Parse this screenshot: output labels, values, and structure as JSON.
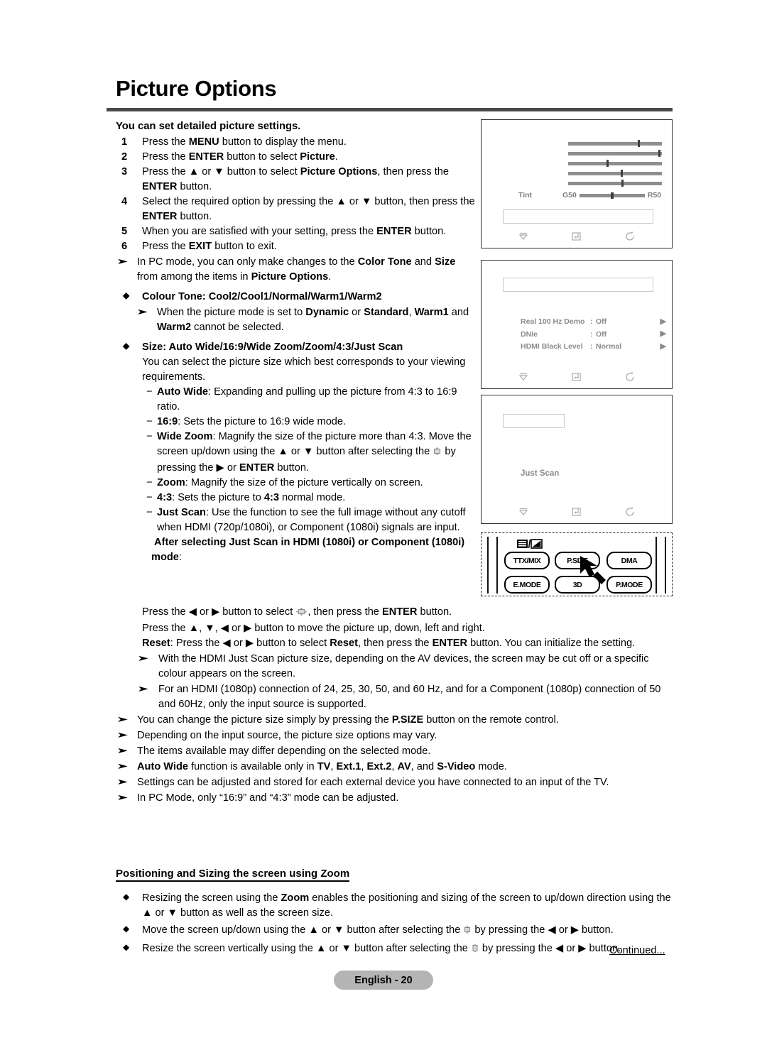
{
  "page": {
    "title": "Picture Options",
    "footer_badge": "English - 20",
    "continued": "Continued..."
  },
  "intro": {
    "lead": "You can set detailed picture settings.",
    "steps": [
      {
        "num": "1",
        "text": "Press the MENU button to display the menu.",
        "parts": [
          "Press the ",
          "MENU",
          " button to display the menu."
        ]
      },
      {
        "num": "2",
        "text": "Press the ENTER button to select Picture."
      },
      {
        "num": "3",
        "text": "Press the ▲ or ▼ button to select Picture Options, then press the ENTER button."
      },
      {
        "num": "4",
        "text": "Select the required option by pressing the ▲ or ▼ button, then press the ENTER button."
      },
      {
        "num": "5",
        "text": "When you are satisfied with your setting, press the ENTER button."
      },
      {
        "num": "6",
        "text": "Press the EXIT button to exit."
      }
    ],
    "pc_note": "In PC mode, you can only make changes to the Color Tone and Size from among the items in Picture Options."
  },
  "colour_tone": {
    "heading": "Colour Tone: Cool2/Cool1/Normal/Warm1/Warm2",
    "note": "When the picture mode is set to Dynamic or Standard, Warm1 and Warm2 cannot be selected."
  },
  "size": {
    "heading": "Size: Auto Wide/16:9/Wide Zoom/Zoom/4:3/Just Scan",
    "body": "You can select the picture size which best corresponds to your viewing requirements.",
    "items": [
      {
        "name": "Auto Wide",
        "desc": ": Expanding and pulling up the picture from 4:3 to 16:9 ratio."
      },
      {
        "name": "16:9",
        "desc": ": Sets the picture to 16:9 wide mode."
      },
      {
        "name": "Wide Zoom",
        "desc": ": Magnify the size of the picture more than 4:3. Move the screen up/down using the ▲ or ▼ button after selecting the ⬚ by pressing the ▶ or ENTER button."
      },
      {
        "name": "Zoom",
        "desc": ": Magnify the size of the picture vertically on screen."
      },
      {
        "name": "4:3",
        "desc": ": Sets the picture to 4:3 normal mode."
      },
      {
        "name": "Just Scan",
        "desc": ": Use the function to see the full image without any cutoff when HDMI (720p/1080i), or Component (1080i) signals are input."
      }
    ],
    "just_scan_heading": "After selecting Just Scan in HDMI (1080i) or Component (1080i) mode:",
    "just_scan_lines": [
      "Press the ◀ or ▶ button to select ⬚, then press the ENTER button.",
      "Press the ▲, ▼, ◀ or ▶ button to move the picture up, down, left and right.",
      "Reset: Press the ◀ or ▶ button to select Reset, then press the ENTER button. You can initialize the setting."
    ],
    "sub_notes": [
      "With the HDMI Just Scan picture size, depending on the AV devices, the screen may be cut off or a specific colour appears on the screen.",
      "For an HDMI (1080p) connection of 24, 25, 30, 50, and 60 Hz, and for a Component (1080p) connection of 50 and 60Hz, only the input source is supported."
    ]
  },
  "general_notes": [
    "You can change the picture size simply by pressing the P.SIZE button on the remote control.",
    "Depending on the input source, the picture size options may vary.",
    "The items available may differ depending on the selected mode.",
    "Auto Wide function is available only in TV, Ext.1, Ext.2, AV, and S-Video mode.",
    "Settings can be adjusted and stored for each external device you have connected to an input of the TV.",
    "In PC Mode, only “16:9” and “4:3” mode can be adjusted."
  ],
  "zoom_section": {
    "heading": "Positioning and Sizing the screen using Zoom",
    "bullets": [
      "Resizing the screen using the Zoom enables the positioning and sizing of the screen to up/down direction using the ▲ or ▼ button as well as the screen size.",
      "Move the screen up/down using the ▲ or ▼ button after selecting the ⬚ by pressing the ◀ or ▶ button.",
      "Resize the screen vertically using the ▲ or ▼ button after selecting the ⬚ by pressing the ◀ or ▶ button."
    ]
  },
  "osd_panels": [
    {
      "id": "tint-panel",
      "tint_label": "Tint",
      "tint_min_label": "G50",
      "tint_max_label": "R50",
      "sliders": [
        {
          "position_pct": 74
        },
        {
          "position_pct": 96
        },
        {
          "position_pct": 41
        },
        {
          "position_pct": 56
        },
        {
          "position_pct": 57
        }
      ],
      "tint_position_pct": 48,
      "footer_icons": [
        "move-icon",
        "enter-icon",
        "return-icon"
      ]
    },
    {
      "id": "options-panel",
      "rows": [
        {
          "name": "Real 100 Hz Demo",
          "value": "Off"
        },
        {
          "name": "DNIe",
          "value": "Off"
        },
        {
          "name": "HDMI Black Level",
          "value": "Normal"
        }
      ],
      "footer_icons": [
        "move-icon",
        "enter-icon",
        "return-icon"
      ]
    },
    {
      "id": "justscan-panel",
      "label": "Just Scan",
      "footer_icons": [
        "move-icon",
        "enter-icon",
        "return-icon"
      ]
    }
  ],
  "remote": {
    "buttons": [
      {
        "key": "ttx",
        "label": "TTX/MIX"
      },
      {
        "key": "psize",
        "label": "P.SIZE"
      },
      {
        "key": "dma",
        "label": "DMA"
      },
      {
        "key": "emode",
        "label": "E.MODE"
      },
      {
        "key": "3d",
        "label": "3D"
      },
      {
        "key": "pmode",
        "label": "P.MODE"
      }
    ]
  }
}
